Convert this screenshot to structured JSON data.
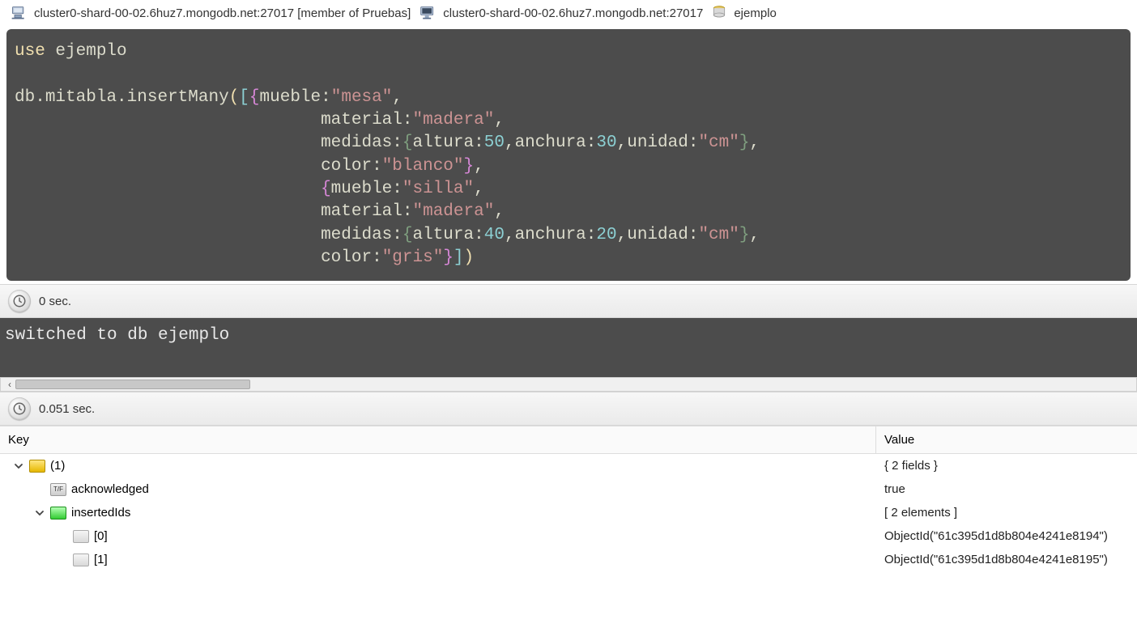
{
  "breadcrumb": {
    "host_with_context": "cluster0-shard-00-02.6huz7.mongodb.net:27017 [member of Pruebas]",
    "host": "cluster0-shard-00-02.6huz7.mongodb.net:27017",
    "database": "ejemplo"
  },
  "editor": {
    "tokens": [
      [
        [
          "kw",
          "use"
        ],
        [
          "p",
          " "
        ],
        [
          "ident",
          "ejemplo"
        ]
      ],
      [],
      [
        [
          "ident",
          "db"
        ],
        [
          "p",
          "."
        ],
        [
          "ident",
          "mitabla"
        ],
        [
          "p",
          "."
        ],
        [
          "fn",
          "insertMany"
        ],
        [
          "by",
          "("
        ],
        [
          "bb",
          "["
        ],
        [
          "bp",
          "{"
        ],
        [
          "ident",
          "mueble"
        ],
        [
          "p",
          ":"
        ],
        [
          "str",
          "\"mesa\""
        ],
        [
          "p",
          ","
        ]
      ],
      [
        [
          "pad",
          "                              "
        ],
        [
          "ident",
          "material"
        ],
        [
          "p",
          ":"
        ],
        [
          "str",
          "\"madera\""
        ],
        [
          "p",
          ","
        ]
      ],
      [
        [
          "pad",
          "                              "
        ],
        [
          "ident",
          "medidas"
        ],
        [
          "p",
          ":"
        ],
        [
          "bg",
          "{"
        ],
        [
          "ident",
          "altura"
        ],
        [
          "p",
          ":"
        ],
        [
          "num",
          "50"
        ],
        [
          "p",
          ","
        ],
        [
          "ident",
          "anchura"
        ],
        [
          "p",
          ":"
        ],
        [
          "num",
          "30"
        ],
        [
          "p",
          ","
        ],
        [
          "ident",
          "unidad"
        ],
        [
          "p",
          ":"
        ],
        [
          "str",
          "\"cm\""
        ],
        [
          "bg",
          "}"
        ],
        [
          "p",
          ","
        ]
      ],
      [
        [
          "pad",
          "                              "
        ],
        [
          "ident",
          "color"
        ],
        [
          "p",
          ":"
        ],
        [
          "str",
          "\"blanco\""
        ],
        [
          "bp",
          "}"
        ],
        [
          "p",
          ","
        ]
      ],
      [
        [
          "pad",
          "                              "
        ],
        [
          "bp",
          "{"
        ],
        [
          "ident",
          "mueble"
        ],
        [
          "p",
          ":"
        ],
        [
          "str",
          "\"silla\""
        ],
        [
          "p",
          ","
        ]
      ],
      [
        [
          "pad",
          "                              "
        ],
        [
          "ident",
          "material"
        ],
        [
          "p",
          ":"
        ],
        [
          "str",
          "\"madera\""
        ],
        [
          "p",
          ","
        ]
      ],
      [
        [
          "pad",
          "                              "
        ],
        [
          "ident",
          "medidas"
        ],
        [
          "p",
          ":"
        ],
        [
          "bg",
          "{"
        ],
        [
          "ident",
          "altura"
        ],
        [
          "p",
          ":"
        ],
        [
          "num",
          "40"
        ],
        [
          "p",
          ","
        ],
        [
          "ident",
          "anchura"
        ],
        [
          "p",
          ":"
        ],
        [
          "num",
          "20"
        ],
        [
          "p",
          ","
        ],
        [
          "ident",
          "unidad"
        ],
        [
          "p",
          ":"
        ],
        [
          "str",
          "\"cm\""
        ],
        [
          "bg",
          "}"
        ],
        [
          "p",
          ","
        ]
      ],
      [
        [
          "pad",
          "                              "
        ],
        [
          "ident",
          "color"
        ],
        [
          "p",
          ":"
        ],
        [
          "str",
          "\"gris\""
        ],
        [
          "bp",
          "}"
        ],
        [
          "bb",
          "]"
        ],
        [
          "by",
          ")"
        ]
      ]
    ]
  },
  "timing": {
    "first": "0 sec.",
    "second": "0.051 sec."
  },
  "console_output": "switched to db ejemplo",
  "results": {
    "headers": {
      "key": "Key",
      "value": "Value"
    },
    "rows": [
      {
        "indent": 0,
        "expandable": true,
        "expanded": true,
        "icon": "obj",
        "key": "(1)",
        "value": "{ 2 fields }"
      },
      {
        "indent": 1,
        "expandable": false,
        "expanded": false,
        "icon": "bool",
        "key": "acknowledged",
        "value": "true"
      },
      {
        "indent": 1,
        "expandable": true,
        "expanded": true,
        "icon": "arr",
        "key": "insertedIds",
        "value": "[ 2 elements ]"
      },
      {
        "indent": 2,
        "expandable": false,
        "expanded": false,
        "icon": "oid",
        "key": "[0]",
        "value": "ObjectId(\"61c395d1d8b804e4241e8194\")"
      },
      {
        "indent": 2,
        "expandable": false,
        "expanded": false,
        "icon": "oid",
        "key": "[1]",
        "value": "ObjectId(\"61c395d1d8b804e4241e8195\")"
      }
    ]
  }
}
